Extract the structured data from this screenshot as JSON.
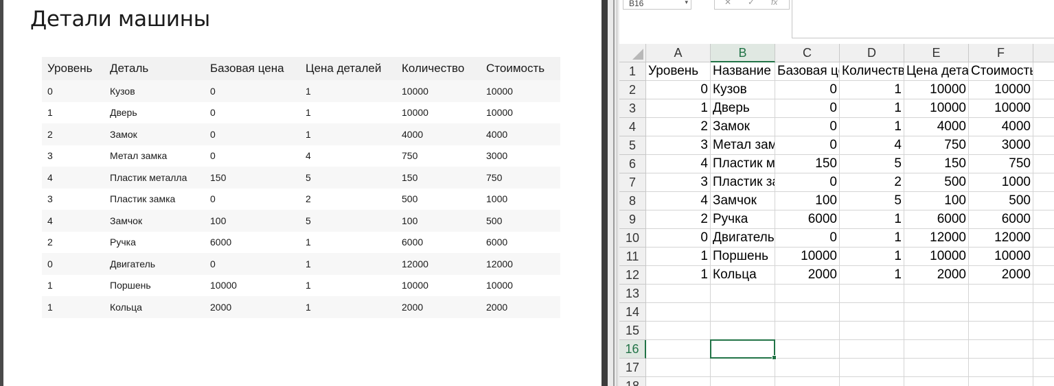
{
  "page": {
    "title": "Детали машины",
    "table": {
      "headers": [
        "Уровень",
        "Деталь",
        "Базовая цена",
        "Цена деталей",
        "Количество",
        "Стоимость"
      ],
      "rows": [
        [
          "0",
          "Кузов",
          "0",
          "1",
          "10000",
          "10000"
        ],
        [
          "1",
          "Дверь",
          "0",
          "1",
          "10000",
          "10000"
        ],
        [
          "2",
          "Замок",
          "0",
          "1",
          "4000",
          "4000"
        ],
        [
          "3",
          "Метал замка",
          "0",
          "4",
          "750",
          "3000"
        ],
        [
          "4",
          "Пластик металла",
          "150",
          "5",
          "150",
          "750"
        ],
        [
          "3",
          "Пластик замка",
          "0",
          "2",
          "500",
          "1000"
        ],
        [
          "4",
          "Замчок",
          "100",
          "5",
          "100",
          "500"
        ],
        [
          "2",
          "Ручка",
          "6000",
          "1",
          "6000",
          "6000"
        ],
        [
          "0",
          "Двигатель",
          "0",
          "1",
          "12000",
          "12000"
        ],
        [
          "1",
          "Поршень",
          "10000",
          "1",
          "10000",
          "10000"
        ],
        [
          "1",
          "Кольца",
          "2000",
          "1",
          "2000",
          "2000"
        ]
      ]
    }
  },
  "excel": {
    "name_box": "B16",
    "formula_icons": [
      "✕",
      "✓",
      "fx"
    ],
    "column_headers": [
      "A",
      "B",
      "C",
      "D",
      "E",
      "F"
    ],
    "row_headers": [
      "1",
      "2",
      "3",
      "4",
      "5",
      "6",
      "7",
      "8",
      "9",
      "10",
      "11",
      "12",
      "13",
      "14",
      "15",
      "16",
      "17",
      "18"
    ],
    "selected_cell": "B16",
    "selected_column": "B",
    "selected_row": "16",
    "accent_color": "#217346",
    "rows": [
      [
        "Уровень",
        "Название",
        "Базовая це",
        "Количеств",
        "Цена дета",
        "Стоимость"
      ],
      [
        "0",
        "Кузов",
        "0",
        "1",
        "10000",
        "10000"
      ],
      [
        "1",
        "Дверь",
        "0",
        "1",
        "10000",
        "10000"
      ],
      [
        "2",
        "Замок",
        "0",
        "1",
        "4000",
        "4000"
      ],
      [
        "3",
        "Метал зам",
        "0",
        "4",
        "750",
        "3000"
      ],
      [
        "4",
        "Пластик м",
        "150",
        "5",
        "150",
        "750"
      ],
      [
        "3",
        "Пластик за",
        "0",
        "2",
        "500",
        "1000"
      ],
      [
        "4",
        "Замчок",
        "100",
        "5",
        "100",
        "500"
      ],
      [
        "2",
        "Ручка",
        "6000",
        "1",
        "6000",
        "6000"
      ],
      [
        "0",
        "Двигатель",
        "0",
        "1",
        "12000",
        "12000"
      ],
      [
        "1",
        "Поршень",
        "10000",
        "1",
        "10000",
        "10000"
      ],
      [
        "1",
        "Кольца",
        "2000",
        "1",
        "2000",
        "2000"
      ]
    ]
  }
}
